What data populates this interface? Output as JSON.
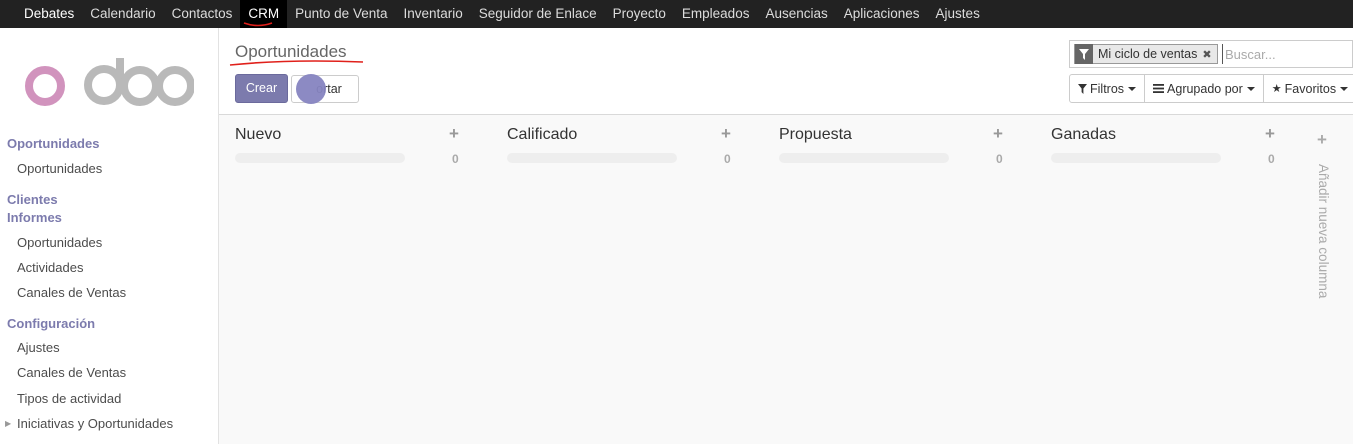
{
  "topbar": {
    "items": [
      "Debates",
      "Calendario",
      "Contactos",
      "CRM",
      "Punto de Venta",
      "Inventario",
      "Seguidor de Enlace",
      "Proyecto",
      "Empleados",
      "Ausencias",
      "Aplicaciones",
      "Ajustes"
    ],
    "active": "CRM"
  },
  "sidebar": {
    "logo_text": "odoo",
    "sections": [
      {
        "title": "Oportunidades",
        "items": [
          "Oportunidades"
        ]
      },
      {
        "title": "Clientes",
        "items": []
      },
      {
        "title": "Informes",
        "items": [
          "Oportunidades",
          "Actividades",
          "Canales de Ventas"
        ]
      },
      {
        "title": "Configuración",
        "items": [
          "Ajustes",
          "Canales de Ventas",
          "Tipos de actividad",
          "Iniciativas y Oportunidades"
        ]
      }
    ]
  },
  "control": {
    "breadcrumb": "Oportunidades",
    "create_label": "Crear",
    "import_label": "Importar",
    "import_visible": "ortar"
  },
  "search": {
    "facet": "Mi ciclo de ventas",
    "placeholder": "Buscar..."
  },
  "filters": {
    "filtros": "Filtros",
    "agrupado": "Agrupado por",
    "favoritos": "Favoritos"
  },
  "kanban": {
    "columns": [
      {
        "title": "Nuevo",
        "count": "0"
      },
      {
        "title": "Calificado",
        "count": "0"
      },
      {
        "title": "Propuesta",
        "count": "0"
      },
      {
        "title": "Ganadas",
        "count": "0"
      }
    ],
    "add_column": "Añadir nueva columna"
  },
  "colors": {
    "brand": "#7c7bad",
    "topbar": "#222222",
    "annotation": "#e0201b"
  }
}
